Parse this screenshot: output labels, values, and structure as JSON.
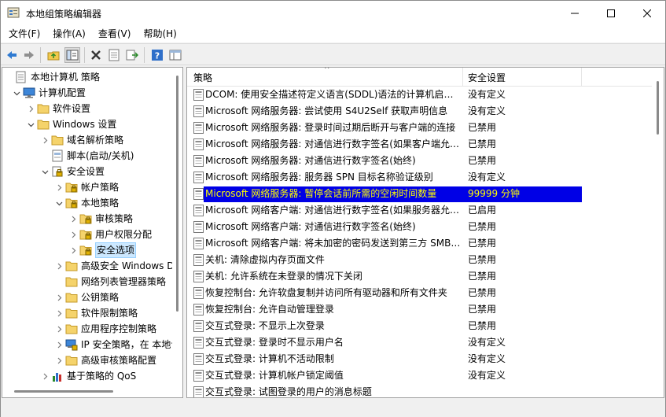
{
  "window": {
    "title": "本地组策略编辑器",
    "controls": {
      "minimize": "minimize-icon",
      "maximize": "maximize-icon",
      "close": "close-icon"
    }
  },
  "menu": [
    "文件(F)",
    "操作(A)",
    "查看(V)",
    "帮助(H)"
  ],
  "toolbar": [
    "back-icon",
    "forward-icon",
    "up-folder-icon",
    "show-tree-icon",
    "delete-icon",
    "properties-icon",
    "export-icon",
    "help-icon",
    "view-icon"
  ],
  "tree": [
    {
      "label": "本地计算机 策略",
      "icon": "computer-policy-icon",
      "chevron": ""
    },
    {
      "label": "计算机配置",
      "icon": "computer-icon",
      "chevron": "expanded"
    },
    {
      "label": "软件设置",
      "icon": "folder-icon",
      "chevron": "collapsed"
    },
    {
      "label": "Windows 设置",
      "icon": "folder-icon",
      "chevron": "expanded"
    },
    {
      "label": "域名解析策略",
      "icon": "folder-icon",
      "chevron": "collapsed"
    },
    {
      "label": "脚本(启动/关机)",
      "icon": "script-icon",
      "chevron": ""
    },
    {
      "label": "安全设置",
      "icon": "security-icon",
      "chevron": "expanded"
    },
    {
      "label": "帐户策略",
      "icon": "security-folder-icon",
      "chevron": "collapsed"
    },
    {
      "label": "本地策略",
      "icon": "security-folder-icon",
      "chevron": "expanded"
    },
    {
      "label": "审核策略",
      "icon": "security-folder-icon",
      "chevron": "collapsed"
    },
    {
      "label": "用户权限分配",
      "icon": "security-folder-icon",
      "chevron": "collapsed"
    },
    {
      "label": "安全选项",
      "icon": "security-folder-icon",
      "chevron": "collapsed",
      "selected": true
    },
    {
      "label": "高级安全 Windows Defender 防火墙",
      "icon": "folder-icon",
      "chevron": "collapsed"
    },
    {
      "label": "网络列表管理器策略",
      "icon": "folder-icon",
      "chevron": ""
    },
    {
      "label": "公钥策略",
      "icon": "folder-icon",
      "chevron": "collapsed"
    },
    {
      "label": "软件限制策略",
      "icon": "folder-icon",
      "chevron": "collapsed"
    },
    {
      "label": "应用程序控制策略",
      "icon": "folder-icon",
      "chevron": "collapsed"
    },
    {
      "label": "IP 安全策略，在 本地计算机",
      "icon": "ip-security-icon",
      "chevron": "collapsed"
    },
    {
      "label": "高级审核策略配置",
      "icon": "folder-icon",
      "chevron": "collapsed"
    },
    {
      "label": "基于策略的 QoS",
      "icon": "qos-chart-icon",
      "chevron": "collapsed"
    }
  ],
  "list": {
    "columns": [
      "策略",
      "安全设置"
    ],
    "rows": [
      {
        "name": "DCOM: 使用安全描述符定义语言(SDDL)语法的计算机启动限制",
        "value": "没有定义"
      },
      {
        "name": "Microsoft 网络服务器: 尝试使用 S4U2Self 获取声明信息",
        "value": "没有定义"
      },
      {
        "name": "Microsoft 网络服务器: 登录时间过期后断开与客户端的连接",
        "value": "已禁用"
      },
      {
        "name": "Microsoft 网络服务器: 对通信进行数字签名(如果客户端允许)",
        "value": "已禁用"
      },
      {
        "name": "Microsoft 网络服务器: 对通信进行数字签名(始终)",
        "value": "已禁用"
      },
      {
        "name": "Microsoft 网络服务器: 服务器 SPN 目标名称验证级别",
        "value": "没有定义"
      },
      {
        "name": "Microsoft 网络服务器: 暂停会话前所需的空闲时间数量",
        "value": "99999 分钟",
        "selected": true
      },
      {
        "name": "Microsoft 网络客户端: 对通信进行数字签名(如果服务器允许)",
        "value": "已启用"
      },
      {
        "name": "Microsoft 网络客户端: 对通信进行数字签名(始终)",
        "value": "已禁用"
      },
      {
        "name": "Microsoft 网络客户端: 将未加密的密码发送到第三方 SMB 服务器",
        "value": "已禁用"
      },
      {
        "name": "关机: 清除虚拟内存页面文件",
        "value": "已禁用"
      },
      {
        "name": "关机: 允许系统在未登录的情况下关闭",
        "value": "已禁用"
      },
      {
        "name": "恢复控制台: 允许软盘复制并访问所有驱动器和所有文件夹",
        "value": "已禁用"
      },
      {
        "name": "恢复控制台: 允许自动管理登录",
        "value": "已禁用"
      },
      {
        "name": "交互式登录: 不显示上次登录",
        "value": "已禁用"
      },
      {
        "name": "交互式登录: 登录时不显示用户名",
        "value": "没有定义"
      },
      {
        "name": "交互式登录: 计算机不活动限制",
        "value": "没有定义"
      },
      {
        "name": "交互式登录: 计算机帐户锁定阈值",
        "value": "没有定义"
      },
      {
        "name": "交互式登录: 试图登录的用户的消息标题",
        "value": ""
      }
    ]
  }
}
